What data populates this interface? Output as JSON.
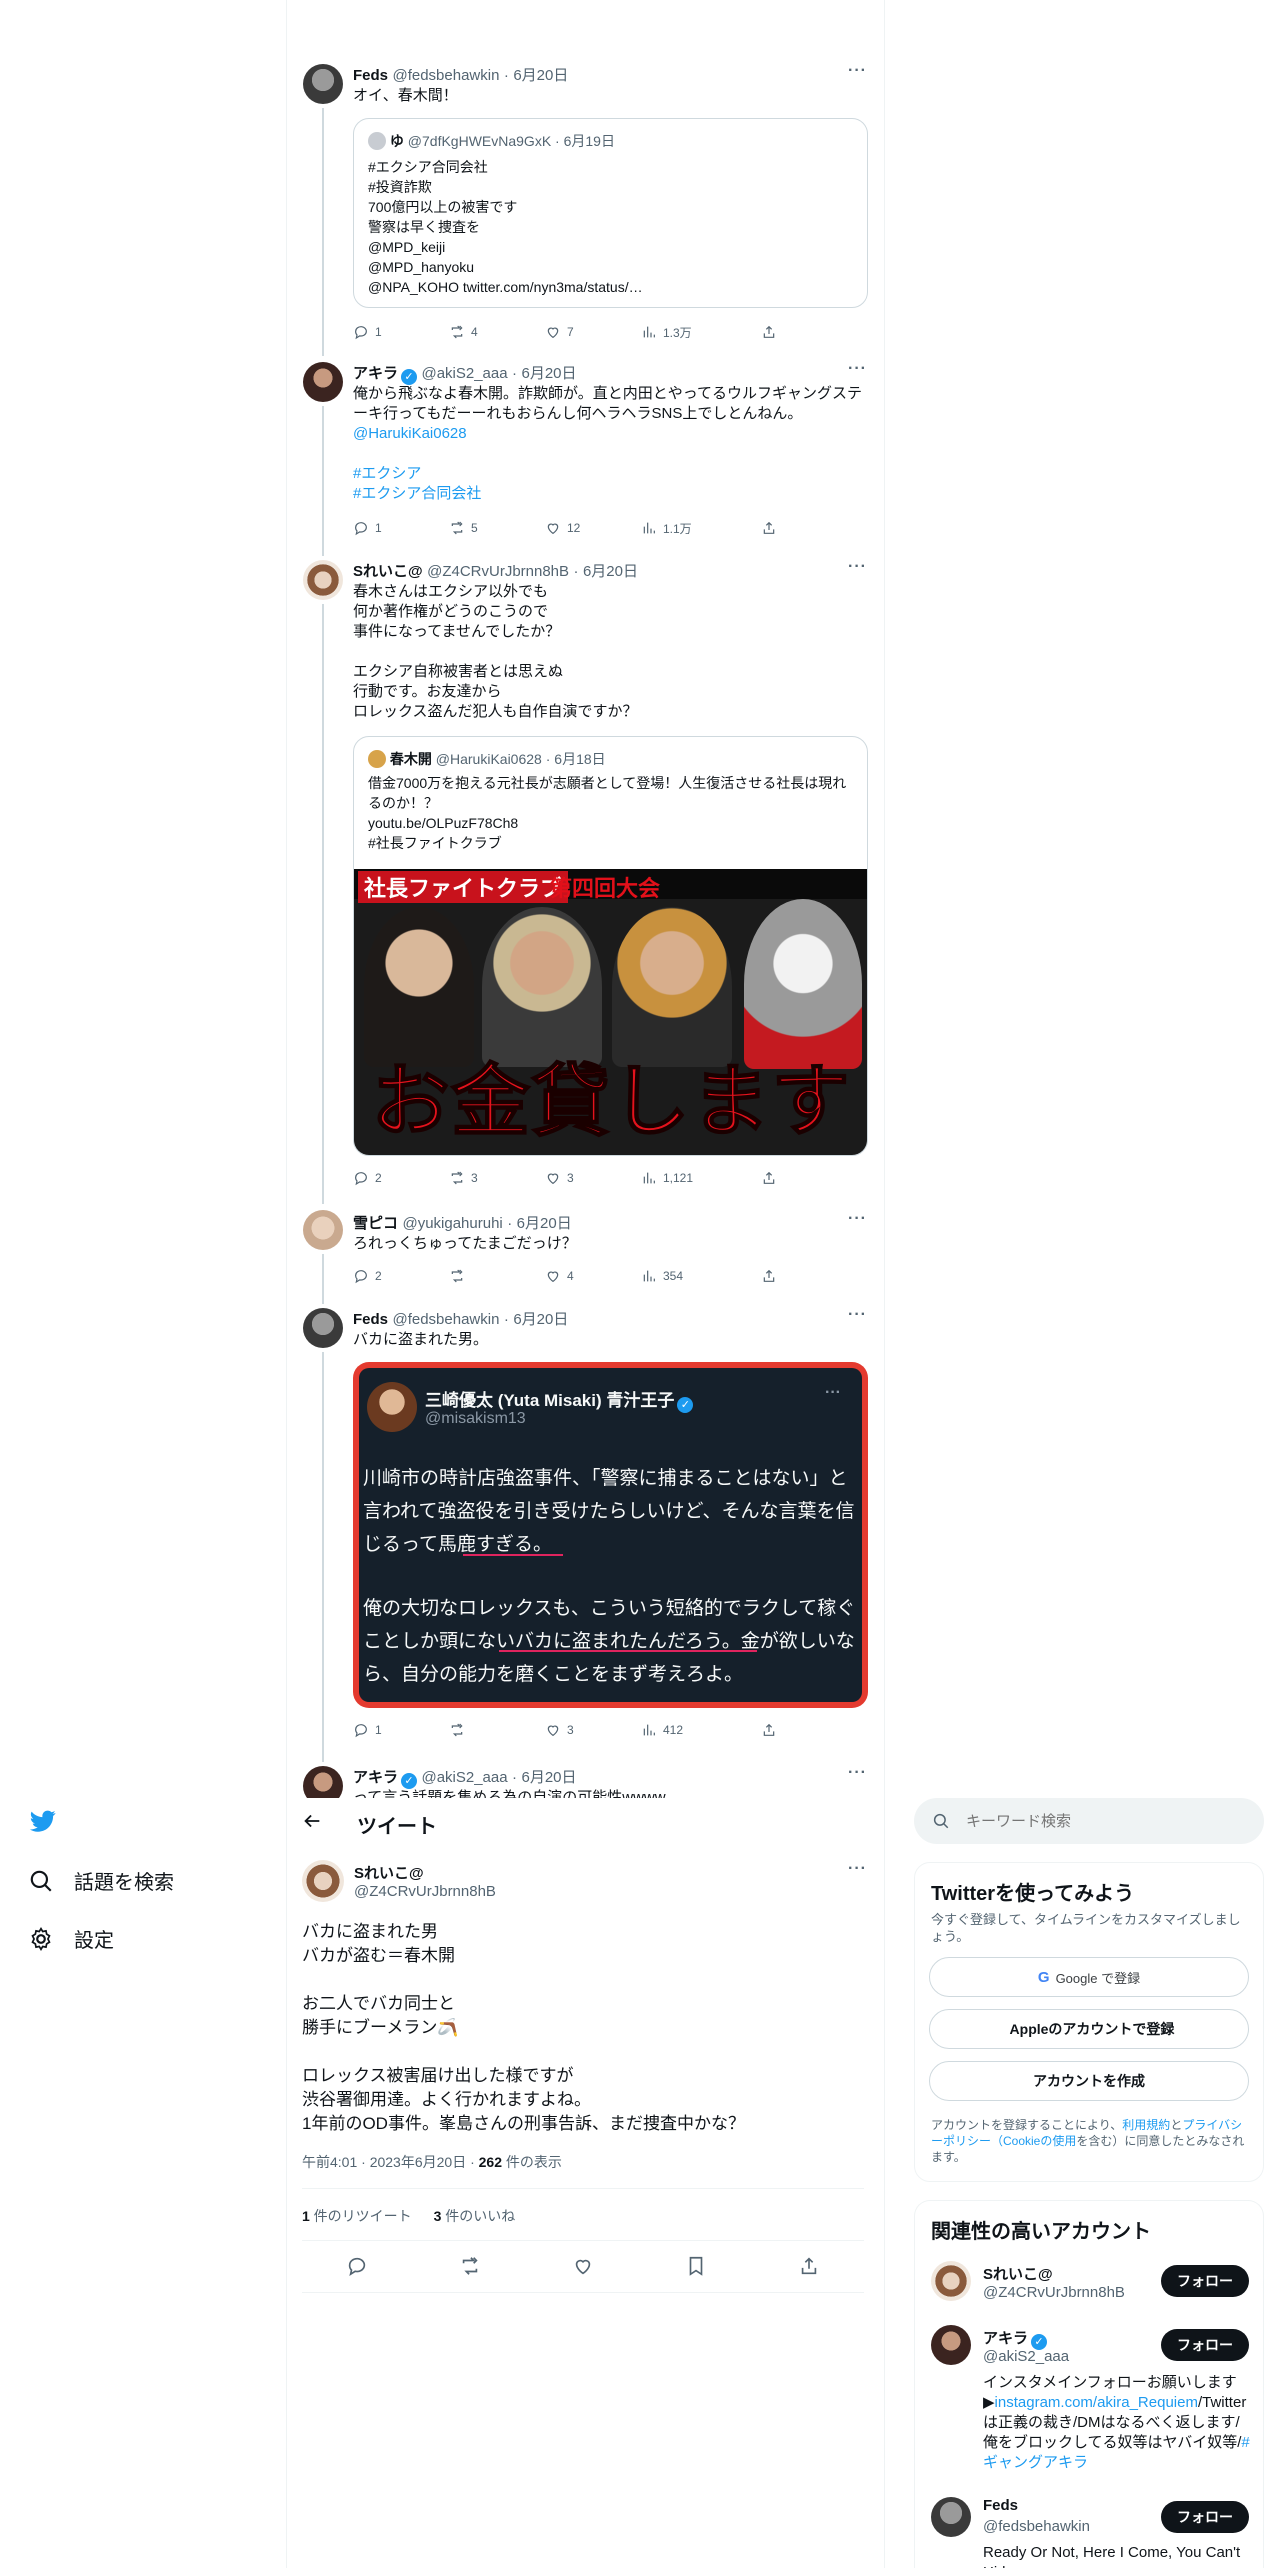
{
  "nav": {
    "explore_label": "話題を検索",
    "settings_label": "設定"
  },
  "header": {
    "title": "ツイート"
  },
  "thread": [
    {
      "name": "Feds",
      "handle": "@fedsbehawkin",
      "date": "6月20日",
      "text": "オイ、春木間！",
      "quote": {
        "name": "ゆ",
        "handle": "@7dfKgHWEvNa9GxK",
        "date": "6月19日",
        "text": "#エクシア合同会社\n#投資詐欺\n700億円以上の被害です\n警察は早く捜査を\n@MPD_keiji\n@MPD_hanyoku\n@NPA_KOHO twitter.com/nyn3ma/status/…"
      },
      "replies": "1",
      "retweets": "4",
      "likes": "7",
      "views": "1.3万"
    },
    {
      "name": "アキラ",
      "handle": "@akiS2_aaa",
      "date": "6月20日",
      "text": "俺から飛ぶなよ春木開。詐欺師が。直と内田とやってるウルフギャングステーキ行ってもだーーれもおらんし何ヘラヘラSNS上でしとんねん。",
      "mention": "@HarukiKai0628",
      "tag1": "#エクシア",
      "tag2": "#エクシア合同会社",
      "replies": "1",
      "retweets": "5",
      "likes": "12",
      "views": "1.1万"
    },
    {
      "name": "Sれいこ@",
      "handle": "@Z4CRvUrJbrnn8hB",
      "date": "6月20日",
      "text": "春木さんはエクシア以外でも\n何か著作権がどうのこうので\n事件になってませんでしたか？\n\nエクシア自称被害者とは思えぬ\n行動です。お友達から\nロレックス盗んだ犯人も自作自演ですか？",
      "quote": {
        "name": "春木開",
        "handle": "@HarukiKai0628",
        "date": "6月18日",
        "text": "借金7000万を抱える元社長が志願者として登場！人生復活させる社長は現れるのか！？\nyoutu.be/OLPuzF78Ch8\n#社長ファイトクラブ",
        "banner_top": "社長ファイトクラブ",
        "banner_top2": "第四回大会",
        "banner_main": "お金貸します"
      },
      "replies": "2",
      "retweets": "3",
      "likes": "3",
      "views": "1,121"
    },
    {
      "name": "雪ピコ",
      "handle": "@yukigahuruhi",
      "date": "6月20日",
      "text": "ろれっくちゅってたまごだっけ？",
      "replies": "2",
      "retweets": "",
      "likes": "4",
      "views": "354"
    },
    {
      "name": "Feds",
      "handle": "@fedsbehawkin",
      "date": "6月20日",
      "text": "バカに盗まれた男。",
      "shot": {
        "name": "三崎優太 (Yuta Misaki) 青汁王子",
        "handle": "@misakism13",
        "para1": "川崎市の時計店強盗事件、「警察に捕まることはない」と言われて強盗役を引き受けたらしいけど、そんな言葉を信じるって馬鹿すぎる。",
        "para2": "俺の大切なロレックスも、こういう短絡的でラクして稼ぐことしか頭にないバカに盗まれたんだろう。金が欲しいなら、自分の能力を磨くことをまず考えろよ。"
      },
      "replies": "1",
      "retweets": "",
      "likes": "3",
      "views": "412"
    },
    {
      "name": "アキラ",
      "handle": "@akiS2_aaa",
      "date": "6月20日",
      "text": "って言う話題を集める為の自演の可能性wwww"
    }
  ],
  "main_tweet": {
    "name": "Sれいこ@",
    "handle": "@Z4CRvUrJbrnn8hB",
    "text": "バカに盗まれた男\nバカが盗む＝春木開\n\nお二人でバカ同士と\n勝手にブーメラン🪃\n\nロレックス被害届け出した様ですが\n渋谷署御用達。よく行かれますよね。\n1年前のOD事件。峯島さんの刑事告訴、まだ捜査中かな？",
    "time": "午前4:01 · 2023年6月20日 · ",
    "views_count": "262",
    "views_label": " 件の表示",
    "retweet_count": "1",
    "retweet_label": " 件のリツイート",
    "like_count": "3",
    "like_label": " 件のいいね"
  },
  "sidebar": {
    "search_placeholder": "キーワード検索",
    "signup": {
      "title": "Twitterを使ってみよう",
      "desc": "今すぐ登録して、タイムラインをカスタマイズしましょう。",
      "google_label": "Google で登録",
      "apple_label": "Appleのアカウントで登録",
      "create_label": "アカウントを作成",
      "legal_prefix": "アカウントを登録することにより、",
      "terms": "利用規約",
      "and": "と",
      "privacy": "プライバシーポリシー（Cookieの使用",
      "legal_suffix": "を含む）に同意したとみなされます。"
    },
    "relevant": {
      "title": "関連性の高いアカウント",
      "follow_label": "フォロー",
      "accounts": [
        {
          "name": "Sれいこ@",
          "handle": "@Z4CRvUrJbrnn8hB"
        },
        {
          "name": "アキラ",
          "handle": "@akiS2_aaa",
          "bio1": "インスタメインフォローお願いします▶",
          "bio_link": "instagram.com/akira_Requiem",
          "bio2": "/Twitterは正義の裁き/DMはなるべく返します/俺をブロックしてる奴等はヤバイ奴等/",
          "bio_tag": "#ギャングアキラ"
        },
        {
          "name": "Feds",
          "handle": "@fedsbehawkin",
          "bio1": "Ready Or Not, Here I Come, You Can't Hide"
        }
      ]
    }
  },
  "colors": {
    "accent": "#1d9bf0",
    "text": "#0f1419",
    "muted": "#536471",
    "border": "#eff3f4"
  }
}
